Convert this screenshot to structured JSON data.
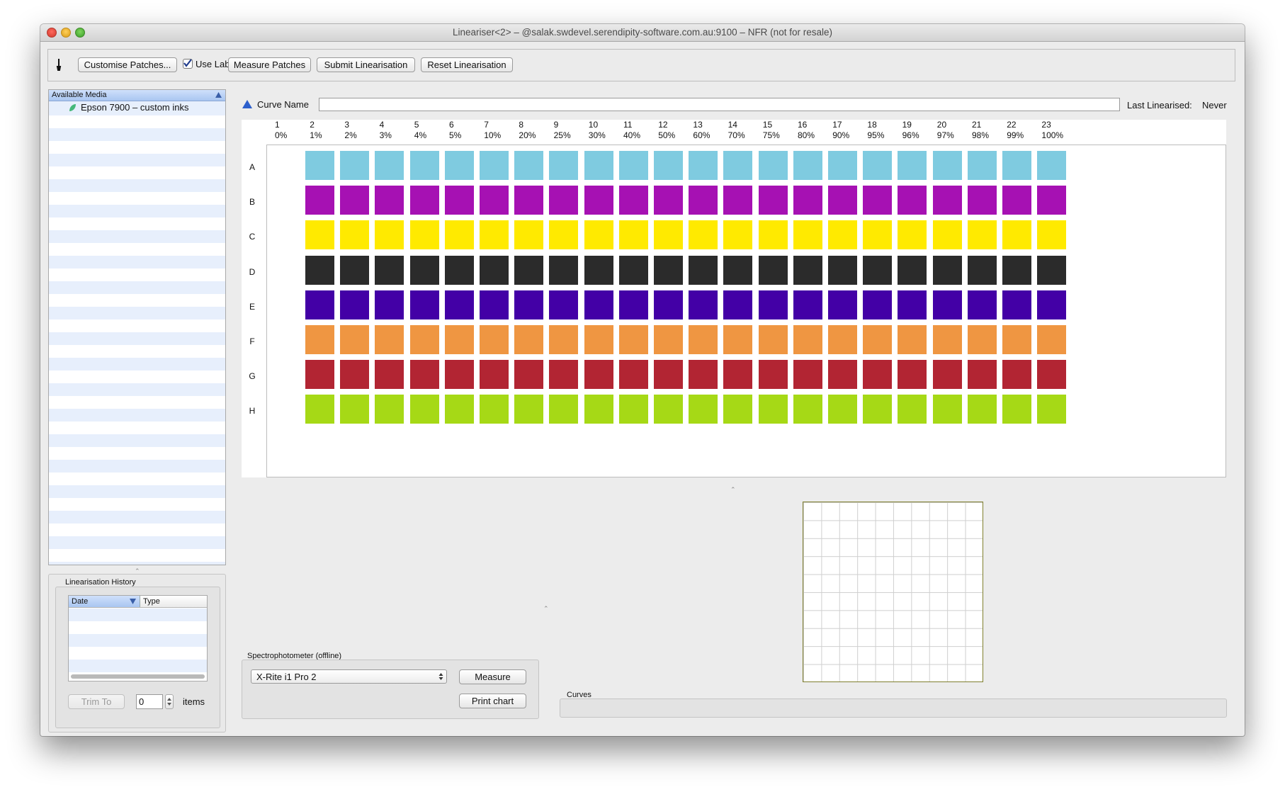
{
  "window": {
    "title": "Lineariser<2> – @salak.swdevel.serendipity-software.com.au:9100 – NFR (not for resale)"
  },
  "toolbar": {
    "customise_label": "Customise Patches...",
    "use_lab_label": "Use Lab",
    "use_lab_checked": true,
    "measure_label": "Measure Patches",
    "submit_label": "Submit Linearisation",
    "reset_label": "Reset Linearisation"
  },
  "media": {
    "header": "Available Media",
    "items": [
      {
        "label": "Epson 7900 – custom inks",
        "icon": "leaf-icon"
      }
    ]
  },
  "history": {
    "title": "Linearisation History",
    "columns": [
      "Date",
      "Type"
    ],
    "trim_label": "Trim To",
    "trim_value": "0",
    "items_label": "items"
  },
  "curve": {
    "name_label": "Curve Name",
    "name_value": "",
    "last_linearised_label": "Last Linearised:",
    "last_linearised_value": "Never"
  },
  "patches": {
    "columns": [
      {
        "num": "1",
        "pct": "0%"
      },
      {
        "num": "2",
        "pct": "1%"
      },
      {
        "num": "3",
        "pct": "2%"
      },
      {
        "num": "4",
        "pct": "3%"
      },
      {
        "num": "5",
        "pct": "4%"
      },
      {
        "num": "6",
        "pct": "5%"
      },
      {
        "num": "7",
        "pct": "10%"
      },
      {
        "num": "8",
        "pct": "20%"
      },
      {
        "num": "9",
        "pct": "25%"
      },
      {
        "num": "10",
        "pct": "30%"
      },
      {
        "num": "11",
        "pct": "40%"
      },
      {
        "num": "12",
        "pct": "50%"
      },
      {
        "num": "13",
        "pct": "60%"
      },
      {
        "num": "14",
        "pct": "70%"
      },
      {
        "num": "15",
        "pct": "75%"
      },
      {
        "num": "16",
        "pct": "80%"
      },
      {
        "num": "17",
        "pct": "90%"
      },
      {
        "num": "18",
        "pct": "95%"
      },
      {
        "num": "19",
        "pct": "96%"
      },
      {
        "num": "20",
        "pct": "97%"
      },
      {
        "num": "21",
        "pct": "98%"
      },
      {
        "num": "22",
        "pct": "99%"
      },
      {
        "num": "23",
        "pct": "100%"
      }
    ],
    "rows": [
      {
        "label": "A",
        "color": "#7fcbe0"
      },
      {
        "label": "B",
        "color": "#a611b3"
      },
      {
        "label": "C",
        "color": "#ffea00"
      },
      {
        "label": "D",
        "color": "#2b2b2b"
      },
      {
        "label": "E",
        "color": "#4300a6"
      },
      {
        "label": "F",
        "color": "#ef9642"
      },
      {
        "label": "G",
        "color": "#b22533"
      },
      {
        "label": "H",
        "color": "#a6d916"
      }
    ]
  },
  "spectro": {
    "title": "Spectrophotometer (offline)",
    "device": "X-Rite i1 Pro 2",
    "measure_label": "Measure",
    "print_label": "Print chart"
  },
  "curves": {
    "title": "Curves"
  }
}
